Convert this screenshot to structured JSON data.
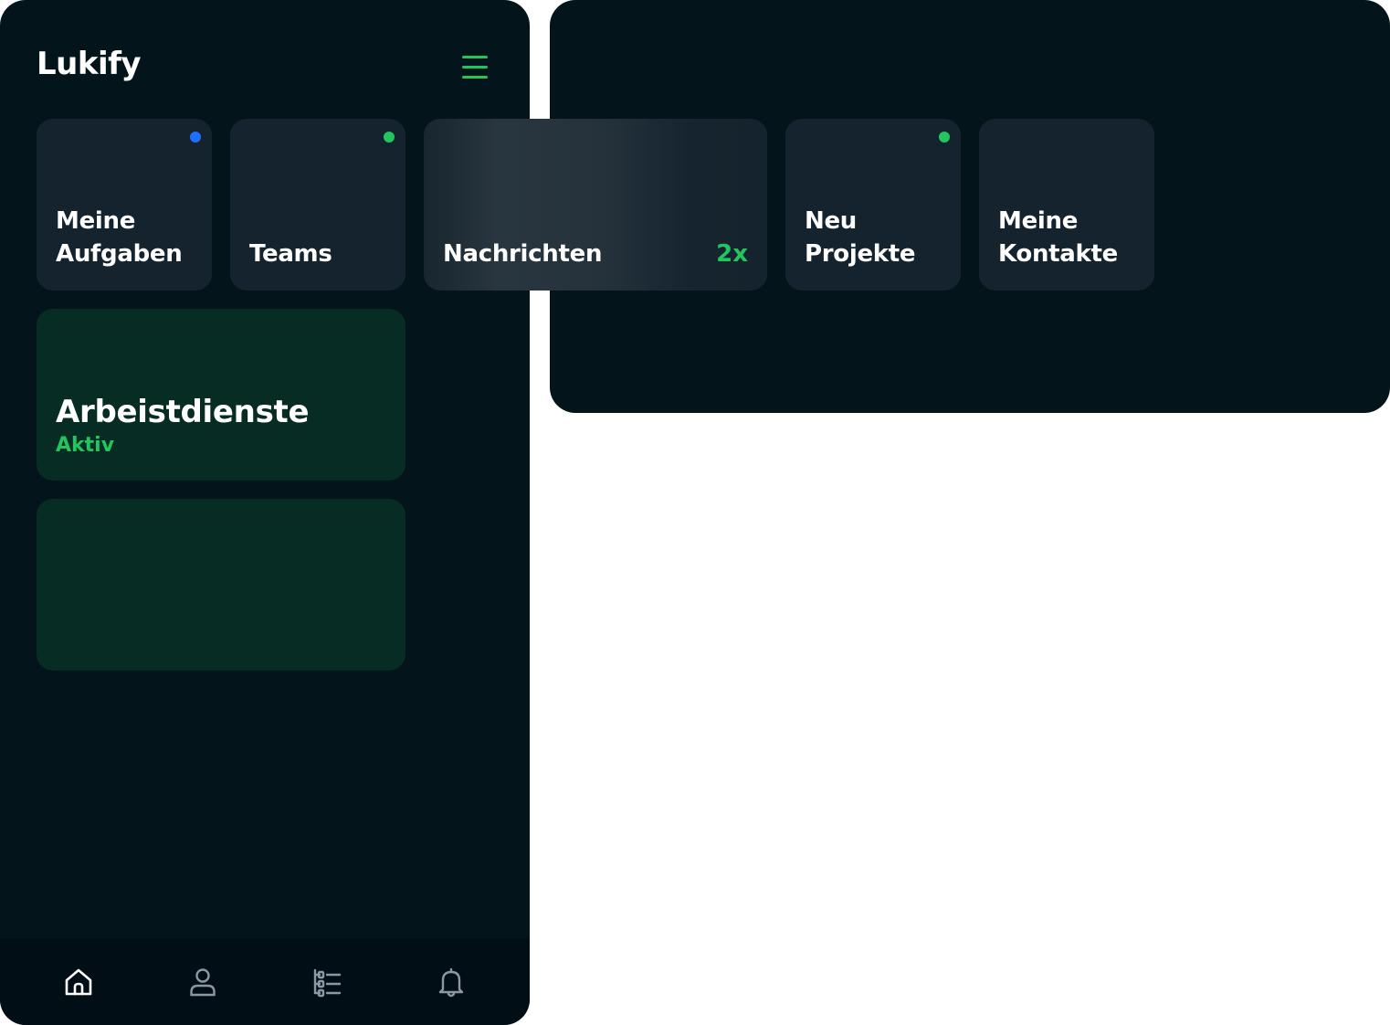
{
  "app": {
    "title": "Lukify"
  },
  "menu": {
    "icon": "menu-icon"
  },
  "tiles": [
    {
      "id": "meine-aufgaben",
      "lines": [
        "Meine",
        "Aufgaben"
      ],
      "dot_color": "#1e6fff"
    },
    {
      "id": "teams",
      "lines": [
        "Teams"
      ],
      "dot_color": "#22c55e"
    },
    {
      "id": "nachrichten",
      "lines": [
        "Nachrichten"
      ],
      "badge": "2x"
    },
    {
      "id": "neu-projekte",
      "lines": [
        "Neu",
        "Projekte"
      ],
      "dot_color": "#22c55e"
    },
    {
      "id": "meine-kontakte",
      "lines": [
        "Meine",
        "Kontakte"
      ]
    }
  ],
  "cards": [
    {
      "title": "Arbeistdienste",
      "status": "Aktiv"
    }
  ],
  "bottom_nav": [
    {
      "icon": "home-icon",
      "active": true
    },
    {
      "icon": "user-icon",
      "active": false
    },
    {
      "icon": "task-list-icon",
      "active": false
    },
    {
      "icon": "bell-icon",
      "active": false
    }
  ],
  "colors": {
    "background": "#03151a",
    "tile": "#15232e",
    "card": "#062c24",
    "accent": "#22c55e",
    "blue_dot": "#1e6fff",
    "nav_bar": "#020e16",
    "nav_active": "#ffffff",
    "nav_inactive": "#8b98a3"
  }
}
